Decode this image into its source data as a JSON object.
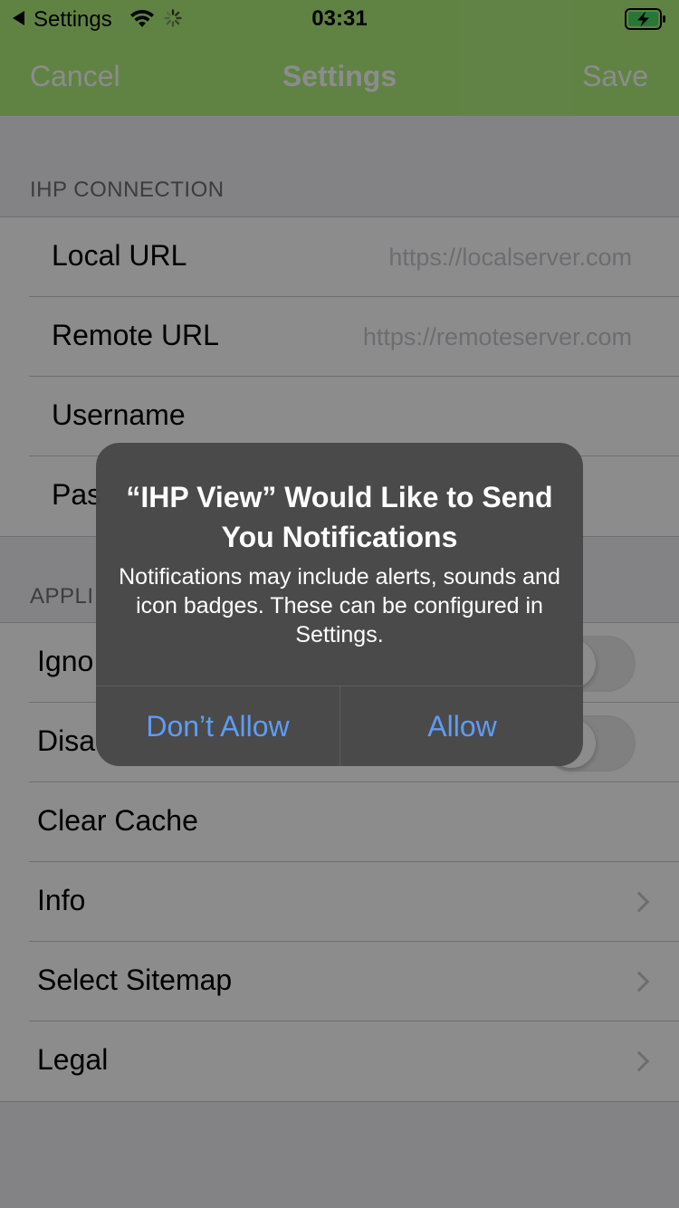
{
  "status_bar": {
    "back_label": "Settings",
    "time": "03:31"
  },
  "nav": {
    "cancel_label": "Cancel",
    "title": "Settings",
    "save_label": "Save"
  },
  "sections": {
    "connection": {
      "header": "IHP CONNECTION",
      "rows": [
        {
          "label": "Local URL",
          "placeholder": "https://localserver.com"
        },
        {
          "label": "Remote URL",
          "placeholder": "https://remoteserver.com"
        },
        {
          "label": "Username"
        },
        {
          "label": "Pas"
        }
      ]
    },
    "application": {
      "header": "APPLI",
      "rows": [
        {
          "label": "Igno"
        },
        {
          "label": "Disa"
        },
        {
          "label": "Clear Cache"
        },
        {
          "label": "Info"
        },
        {
          "label": "Select Sitemap"
        },
        {
          "label": "Legal"
        }
      ]
    }
  },
  "alert": {
    "title": "“IHP View” Would Like to Send You Notifications",
    "message": "Notifications may include alerts, sounds and icon badges. These can be configured in Settings.",
    "dont_allow_label": "Don’t Allow",
    "allow_label": "Allow"
  },
  "colors": {
    "nav_bar": "#b0ee7d",
    "alert_button": "#5e9cf5"
  }
}
